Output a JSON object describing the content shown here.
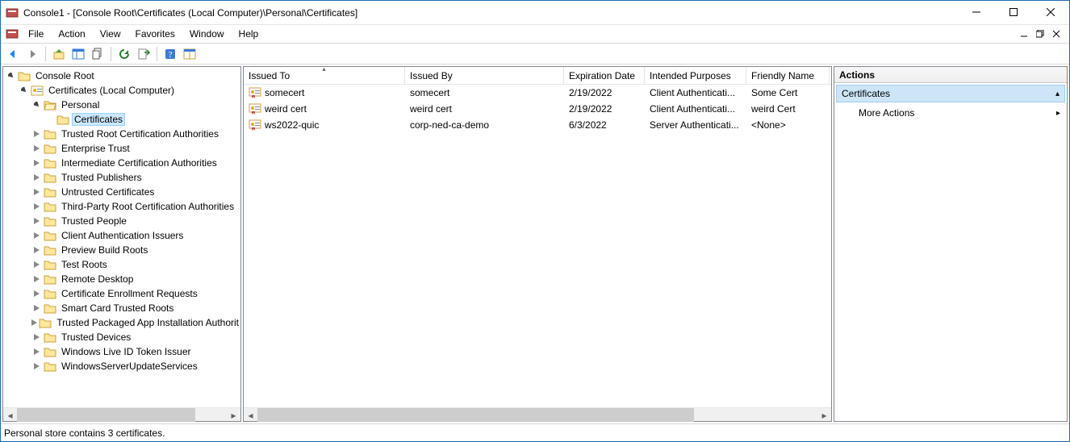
{
  "window": {
    "title": "Console1 - [Console Root\\Certificates (Local Computer)\\Personal\\Certificates]"
  },
  "menu": {
    "file": "File",
    "action": "Action",
    "view": "View",
    "favorites": "Favorites",
    "window": "Window",
    "help": "Help"
  },
  "tree": {
    "root": "Console Root",
    "certs": "Certificates (Local Computer)",
    "personal": "Personal",
    "certificates": "Certificates",
    "items": [
      "Trusted Root Certification Authorities",
      "Enterprise Trust",
      "Intermediate Certification Authorities",
      "Trusted Publishers",
      "Untrusted Certificates",
      "Third-Party Root Certification Authorities",
      "Trusted People",
      "Client Authentication Issuers",
      "Preview Build Roots",
      "Test Roots",
      "Remote Desktop",
      "Certificate Enrollment Requests",
      "Smart Card Trusted Roots",
      "Trusted Packaged App Installation Authorit",
      "Trusted Devices",
      "Windows Live ID Token Issuer",
      "WindowsServerUpdateServices"
    ]
  },
  "columns": {
    "c0": "Issued To",
    "c1": "Issued By",
    "c2": "Expiration Date",
    "c3": "Intended Purposes",
    "c4": "Friendly Name"
  },
  "rows": [
    {
      "to": "somecert",
      "by": "somecert",
      "exp": "2/19/2022",
      "purpose": "Client Authenticati...",
      "friendly": "Some Cert"
    },
    {
      "to": "weird cert",
      "by": "weird cert",
      "exp": "2/19/2022",
      "purpose": "Client Authenticati...",
      "friendly": "weird Cert"
    },
    {
      "to": "ws2022-quic",
      "by": "corp-ned-ca-demo",
      "exp": "6/3/2022",
      "purpose": "Server Authenticati...",
      "friendly": "<None>"
    }
  ],
  "actions": {
    "header": "Actions",
    "section": "Certificates",
    "more": "More Actions"
  },
  "status": "Personal store contains 3 certificates."
}
